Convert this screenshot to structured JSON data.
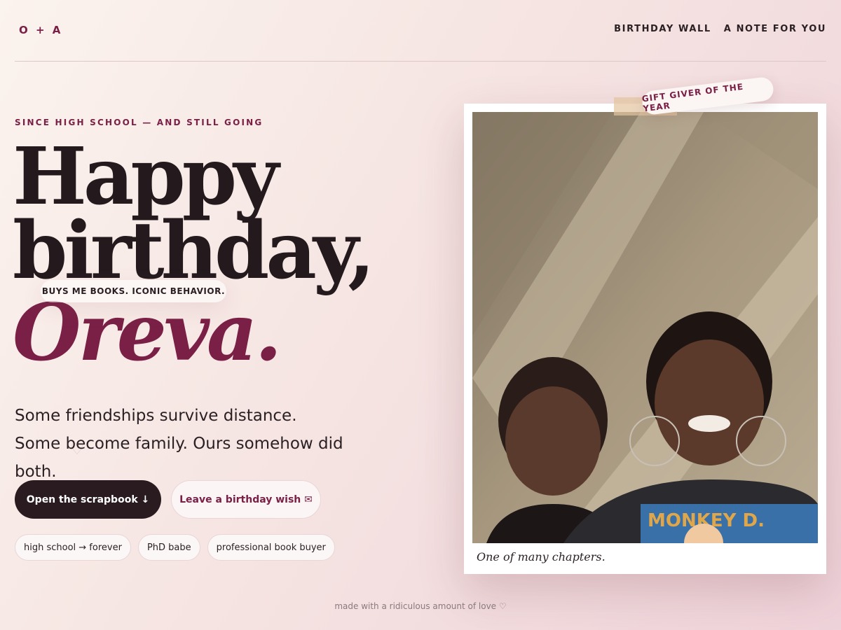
{
  "nav": {
    "brand": "O + A",
    "links": [
      "BIRTHDAY WALL",
      "A NOTE FOR YOU"
    ]
  },
  "hero": {
    "eyebrow": "SINCE HIGH SCHOOL — AND STILL GOING",
    "title_line1": "Happy",
    "title_line2": "birthday,",
    "name": "Oreva.",
    "sticker": "BUYS ME BOOKS. ICONIC BEHAVIOR.",
    "lede": "Some friendships survive distance. Some become family. Ours somehow did both."
  },
  "actions": {
    "primary": "Open the scrapbook ↓",
    "secondary": "Leave a birthday wish ✉"
  },
  "chips": [
    "high school → forever",
    "PhD babe",
    "professional book buyer"
  ],
  "polaroid": {
    "tag": "GIFT GIVER OF THE YEAR",
    "caption": "One of many chapters."
  },
  "footer": "made with a ridiculous amount of love ♡",
  "colors": {
    "accent": "#7a2046",
    "ink": "#241a1e",
    "background": "#f6e6e3"
  }
}
